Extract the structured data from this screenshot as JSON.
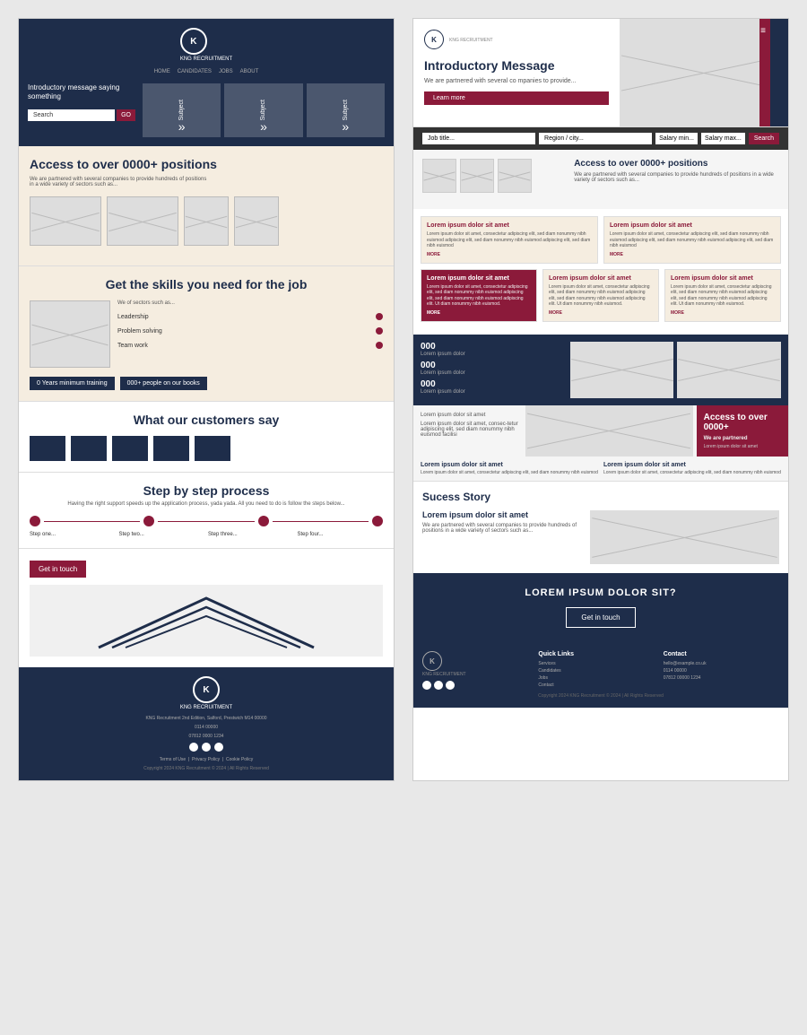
{
  "left": {
    "hero": {
      "logo_letter": "K",
      "logo_subtext": "KNG RECRUITMENT",
      "nav_items": [
        "HOME",
        "CANDIDATES",
        "JOBS",
        "ABOUT"
      ],
      "intro_text": "Introductory message saying something",
      "search_placeholder": "Search",
      "search_button": "GO",
      "subjects": [
        "Subject",
        "Subject",
        "Subject"
      ]
    },
    "access": {
      "title": "Access to over 0000+ positions",
      "desc": "We are partnered with several companies to provide hundreds of positions in a wide variety of sectors such as..."
    },
    "skills": {
      "title": "Get the skills you need for the job",
      "subtitle": "We of sectors such as...",
      "items": [
        "Leadership",
        "Problem solving",
        "Team work"
      ],
      "stat1": "0 Years minimum training",
      "stat2": "000+ people on our books"
    },
    "customers": {
      "title": "What our customers say"
    },
    "steps": {
      "title": "Step by step process",
      "desc": "Having the right support speeds up the application process, yada yada. All you need to do is follow the steps below...",
      "steps": [
        "Step one...",
        "Step two...",
        "Step three...",
        "Step four..."
      ]
    },
    "cta": {
      "button": "Get in touch"
    },
    "footer": {
      "logo_letter": "K",
      "address": "KNG Recruitment 2nd Edition, Salford, Prestwich M14 00000",
      "phone": "0114 00000",
      "mobile": "07812 0000 1234",
      "social_icons": [
        "f",
        "t",
        "in"
      ],
      "links": [
        "Terms of Use",
        "Privacy Policy",
        "Cookie Policy"
      ],
      "copy": "Copyright 2024 KNG Recruitment © 2024 | All Rights Reserved"
    }
  },
  "right": {
    "hero": {
      "logo_letter": "K",
      "logo_subtext": "KNG RECRUITMENT",
      "menu_icon": "≡",
      "intro_title": "Introductory Message",
      "intro_desc": "We are partnered with several co mpanies to provide...",
      "cta_button": "Learn more"
    },
    "search": {
      "job_placeholder": "Job title...",
      "region_placeholder": "Region / city...",
      "salary_min_placeholder": "Salary min...",
      "salary_max_placeholder": "Salary max...",
      "search_button": "Search"
    },
    "access": {
      "title": "Access to over 0000+ positions",
      "desc": "We are partnered with several companies to provide hundreds of positions in a wide variety of sectors such as..."
    },
    "cards_row1": [
      {
        "title": "Lorem ipsum dolor sit amet",
        "body": "Lorem ipsum dolor sit amet, consectetur adipiscing elit, sed diam nonummy nibh euismod adipiscing elit, sed diam nonummy nibh euismod adipiscing elit, sed diam nibh euismod",
        "more": "MORE"
      },
      {
        "title": "Lorem ipsum dolor sit amet",
        "body": "Lorem ipsum dolor sit amet, consectetur adipiscing elit, sed diam nonummy nibh euismod adipiscing elit, sed diam nonummy nibh euismod adipiscing elit, sed diam nibh euismod",
        "more": "MORE"
      }
    ],
    "cards_row2": [
      {
        "title": "Lorem ipsum dolor sit amet",
        "body": "Lorem ipsum dolor sit amet, consectetur adipiscing elit, sed diam nonummy nibh euismod adipiscing elit, sed diam nonummy nibh euismod adipiscing elit. Ut diam nonummy nibh euismod.",
        "more": "MORE",
        "dark": true
      },
      {
        "title": "Lorem ipsum dolor sit amet",
        "body": "Lorem ipsum dolor sit amet, consectetur adipiscing elit, sed diam nonummy nibh euismod adipiscing elit, sed diam nonummy nibh euismod adipiscing elit. Ut diam nonummy nibh euismod.",
        "more": "MORE"
      },
      {
        "title": "Lorem ipsum dolor sit amet",
        "body": "Lorem ipsum dolor sit amet, consectetur adipiscing elit, sed diam nonummy nibh euismod adipiscing elit, sed diam nonummy nibh euismod adipiscing elit. Ut diam nonummy nibh euismod.",
        "more": "MORE"
      }
    ],
    "stats": [
      {
        "number": "000",
        "label": "Lorem ipsum dolor"
      },
      {
        "number": "000",
        "label": "Lorem ipsum dolor"
      },
      {
        "number": "000",
        "label": "Lorem ipsum dolor"
      }
    ],
    "stat_captions": [
      {
        "title": "Lorem ipsum dolor sit amet",
        "body": "Lorem ipsum dolor sit amet, consectetur adipiscing elit, sed diam nonummy nibh euismod"
      },
      {
        "title": "Lorem ipsum dolor sit amet",
        "body": "Lorem ipsum dolor sit amet, consectetur adipiscing elit, sed diam nonummy nibh euismod"
      }
    ],
    "access_over": {
      "title": "Access to over 0000+",
      "subtitle": "We are partnered",
      "crimson_title": "Lorem ipsum dolor sit amet",
      "text1": "Lorem ipsum dolor sit amet",
      "text2": "Lorem ipsum dolor sit amet, consec-tetur adipiscing elit, sed diam nonummy nibh euismod facilisi"
    },
    "success": {
      "title": "Sucess Story",
      "lorem_title": "Lorem ipsum dolor sit amet",
      "desc": "We are partnered with several companies to provide hundreds of positions in a wide variety of sectors such as..."
    },
    "cta": {
      "title": "LOREM IPSUM DOLOR SIT?",
      "button": "Get in touch"
    },
    "footer": {
      "logo_letter": "K",
      "links_title": "Quick Links",
      "links": [
        "Services",
        "Candidates",
        "Jobs",
        "Contact"
      ],
      "contact_title": "Contact",
      "contact_items": [
        "hello@example.co.uk",
        "0114 00000",
        "07812 00000 1234"
      ],
      "copy": "Copyright 2024 KNG Recruitment © 2024 | All Rights Reserved"
    }
  }
}
